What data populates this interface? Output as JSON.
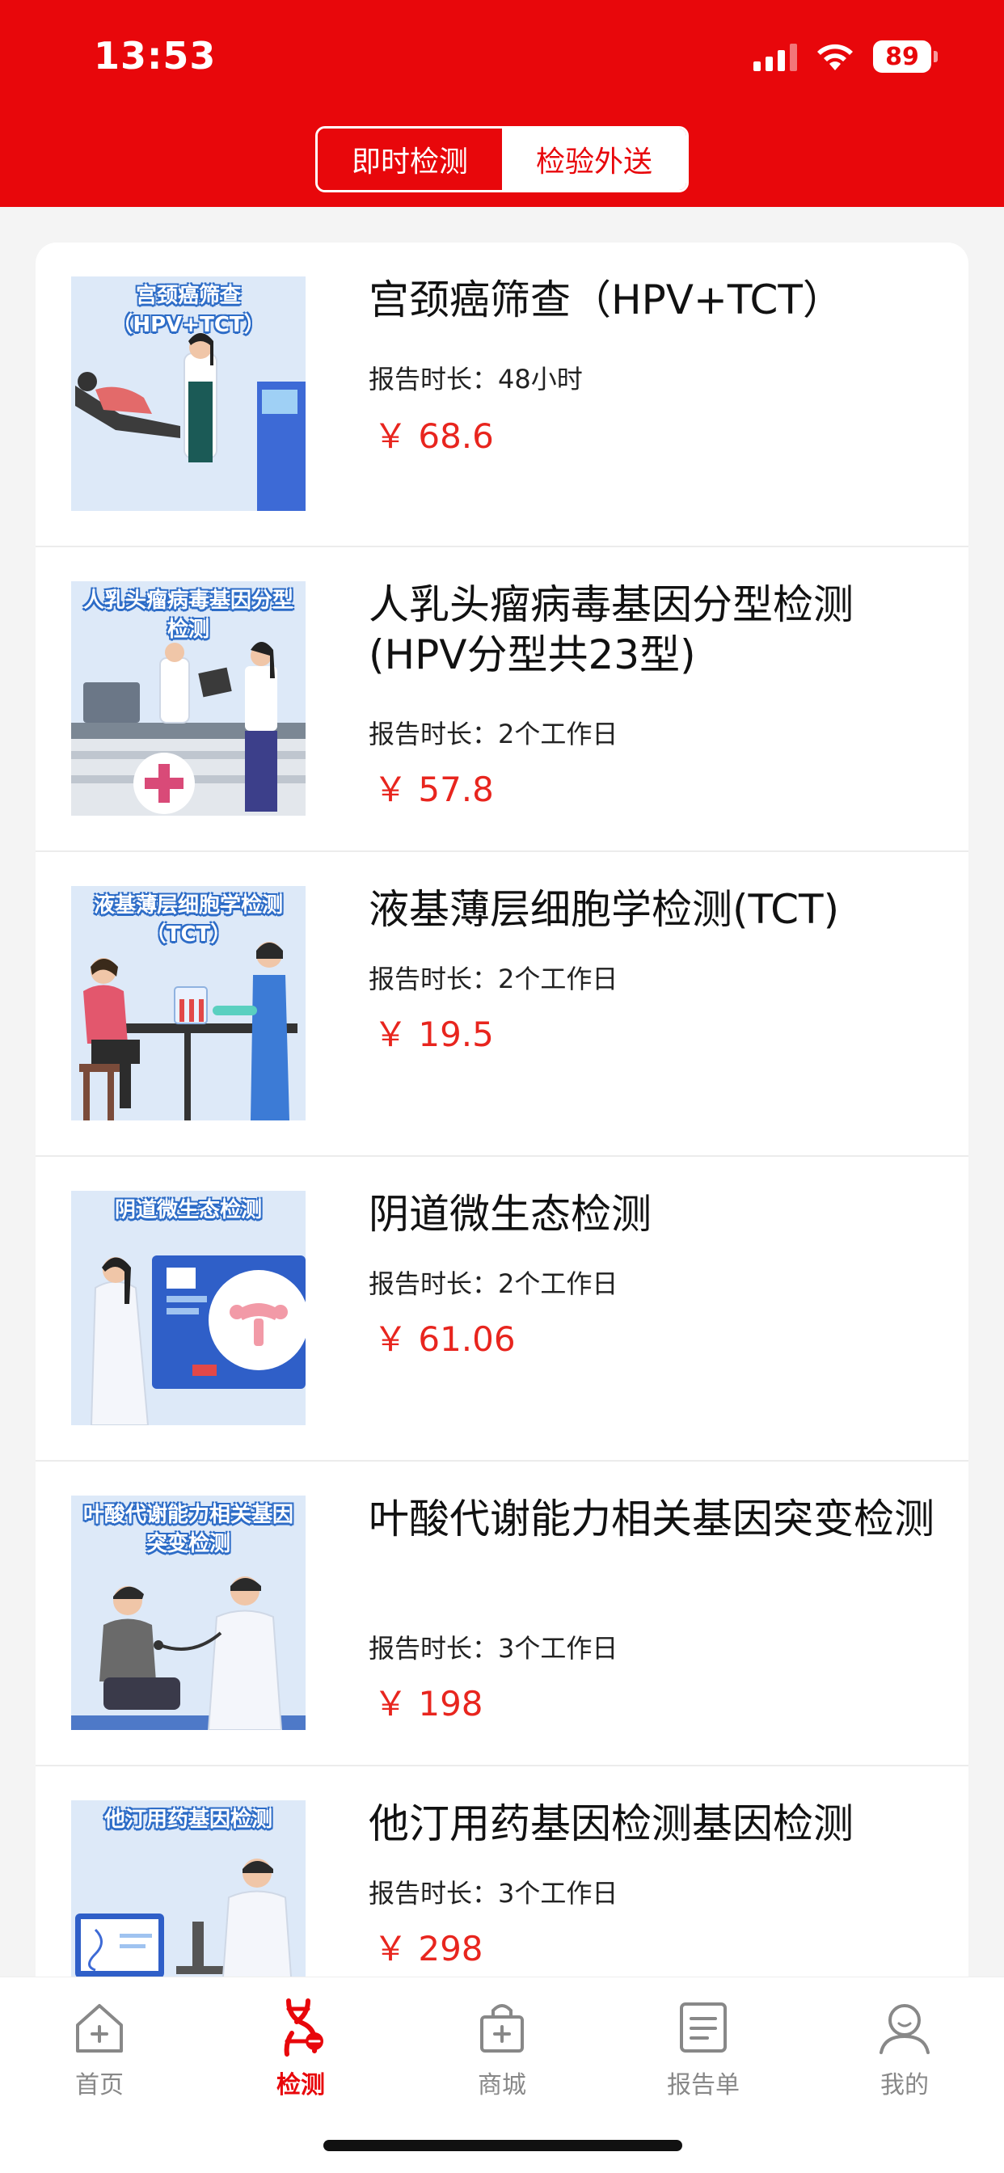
{
  "status_bar": {
    "time": "13:53",
    "battery": "89"
  },
  "segment": {
    "tabs": [
      "即时检测",
      "检验外送"
    ],
    "active_index": 1
  },
  "colors": {
    "brand": "#e8070b",
    "price": "#e8251e"
  },
  "items": [
    {
      "thumb_title": "宫颈癌筛查（HPV+TCT）",
      "name": "宫颈癌筛查（HPV+TCT）",
      "duration": "报告时长：48小时",
      "price": "￥ 68.6"
    },
    {
      "thumb_title": "人乳头瘤病毒基因分型检测",
      "name": "人乳头瘤病毒基因分型检测(HPV分型共23型)",
      "duration": "报告时长：2个工作日",
      "price": "￥ 57.8"
    },
    {
      "thumb_title": "液基薄层细胞学检测（TCT）",
      "name": "液基薄层细胞学检测(TCT)",
      "duration": "报告时长：2个工作日",
      "price": "￥ 19.5"
    },
    {
      "thumb_title": "阴道微生态检测",
      "name": "阴道微生态检测",
      "duration": "报告时长：2个工作日",
      "price": "￥ 61.06"
    },
    {
      "thumb_title": "叶酸代谢能力相关基因突变检测",
      "name": "叶酸代谢能力相关基因突变检测",
      "duration": "报告时长：3个工作日",
      "price": "￥ 198"
    },
    {
      "thumb_title": "他汀用药基因检测",
      "name": "他汀用药基因检测基因检测",
      "duration": "报告时长：3个工作日",
      "price": "￥ 298"
    }
  ],
  "tabbar": [
    {
      "label": "首页",
      "icon": "home-icon",
      "active": false
    },
    {
      "label": "检测",
      "icon": "dna-icon",
      "active": true
    },
    {
      "label": "商城",
      "icon": "shopping-bag-icon",
      "active": false
    },
    {
      "label": "报告单",
      "icon": "report-icon",
      "active": false
    },
    {
      "label": "我的",
      "icon": "profile-icon",
      "active": false
    }
  ]
}
